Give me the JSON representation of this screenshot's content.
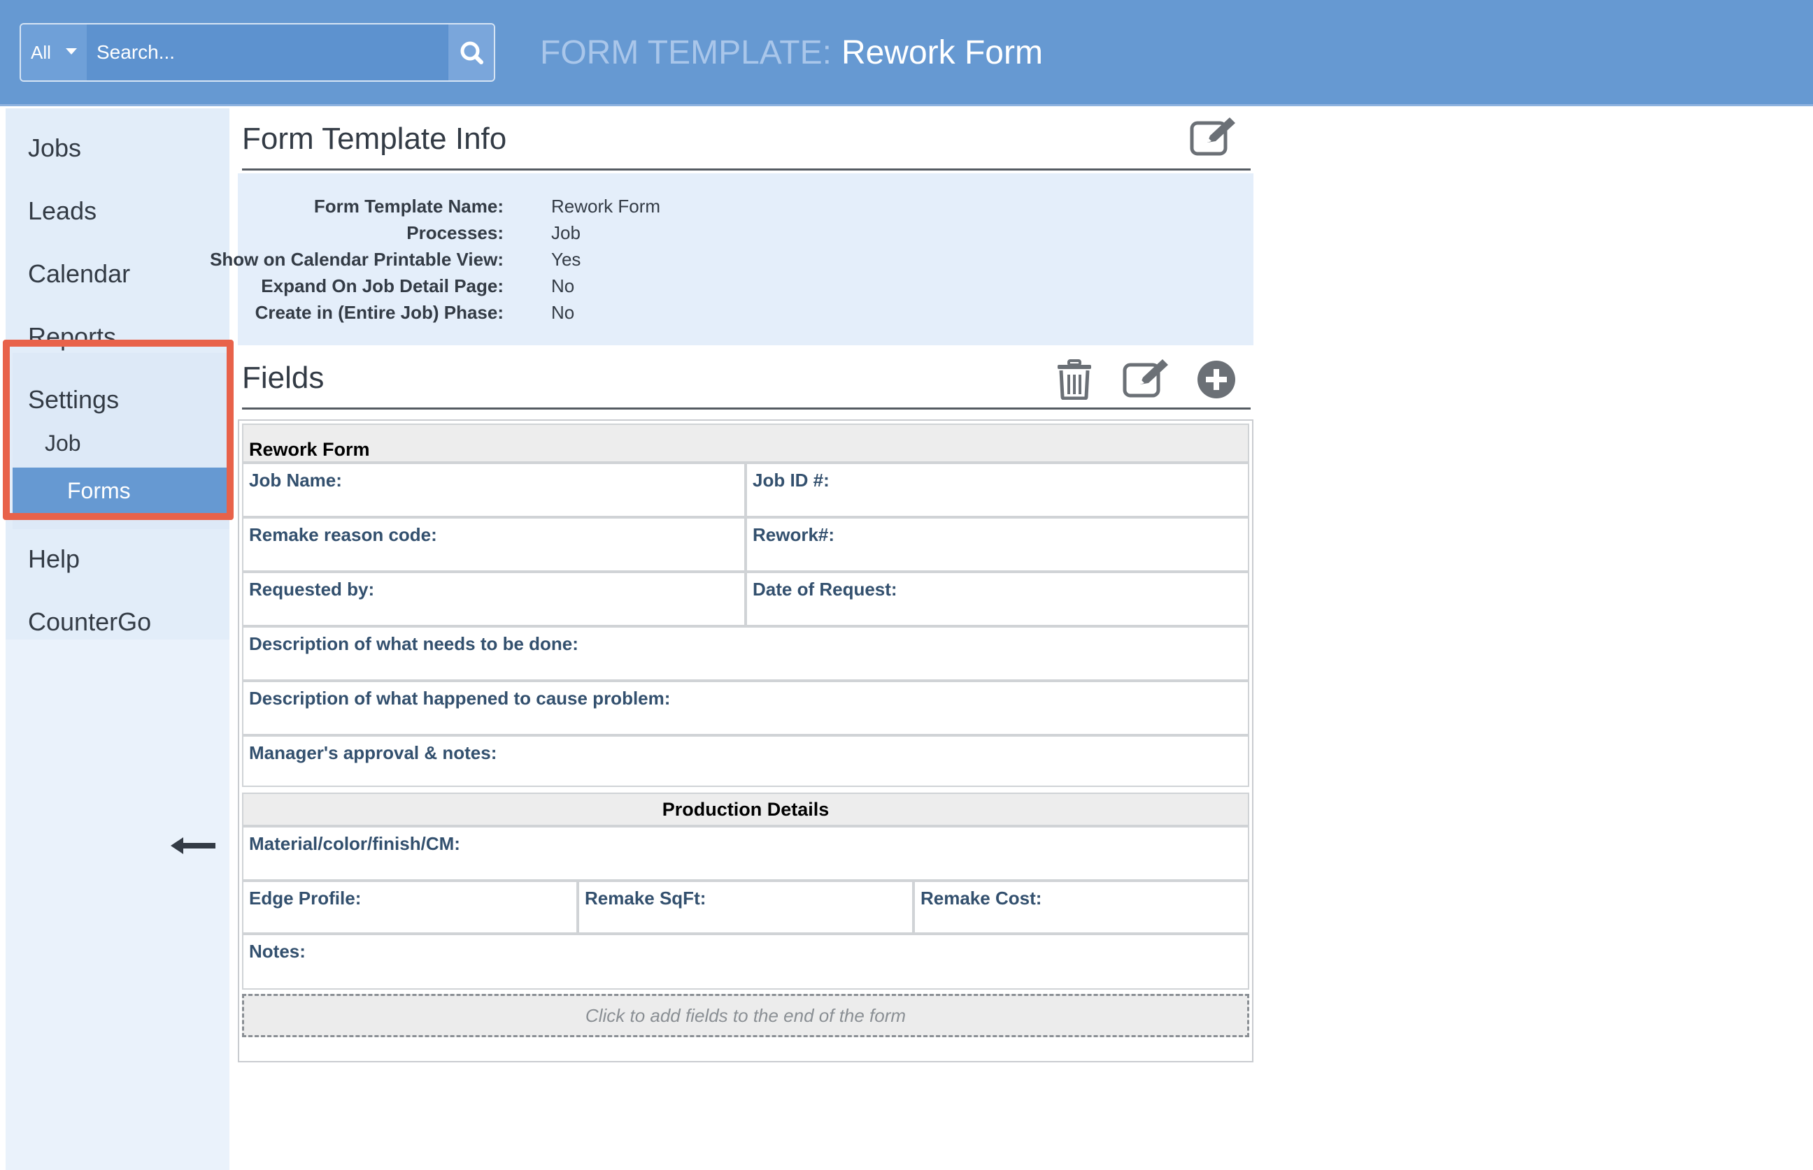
{
  "header": {
    "search_scope": "All",
    "search_placeholder": "Search...",
    "title_prefix": "FORM TEMPLATE:",
    "title_name": "Rework Form"
  },
  "sidebar": {
    "items": [
      {
        "label": "Jobs"
      },
      {
        "label": "Leads"
      },
      {
        "label": "Calendar"
      },
      {
        "label": "Reports"
      },
      {
        "label": "Settings"
      },
      {
        "label": "Help"
      },
      {
        "label": "CounterGo"
      }
    ],
    "sub_items": [
      {
        "label": "Job"
      },
      {
        "label": "Forms"
      }
    ],
    "highlight_color": "#e8624a",
    "active_color": "#6699d2"
  },
  "info": {
    "title": "Form Template Info",
    "rows": [
      {
        "label": "Form Template Name:",
        "value": "Rework Form"
      },
      {
        "label": "Processes:",
        "value": "Job"
      },
      {
        "label": "Show on Calendar Printable View:",
        "value": "Yes"
      },
      {
        "label": "Expand On Job Detail Page:",
        "value": "No"
      },
      {
        "label": "Create in (Entire Job) Phase:",
        "value": "No"
      }
    ]
  },
  "fields": {
    "title": "Fields",
    "form_title": "Rework Form",
    "labels": {
      "job_name": "Job Name:",
      "job_id": "Job ID #:",
      "remake_reason": "Remake reason code:",
      "rework_no": "Rework#:",
      "requested_by": "Requested by:",
      "date_of_request": "Date of Request:",
      "desc_needed": "Description of what needs to be done:",
      "desc_cause": "Description of what happened to cause problem:",
      "manager_approval": "Manager's approval & notes:",
      "production_details": "Production Details",
      "material": "Material/color/finish/CM:",
      "edge_profile": "Edge Profile:",
      "remake_sqft": "Remake SqFt:",
      "remake_cost": "Remake Cost:",
      "notes": "Notes:"
    },
    "add_fields_hint": "Click to add fields to the end of the form"
  }
}
